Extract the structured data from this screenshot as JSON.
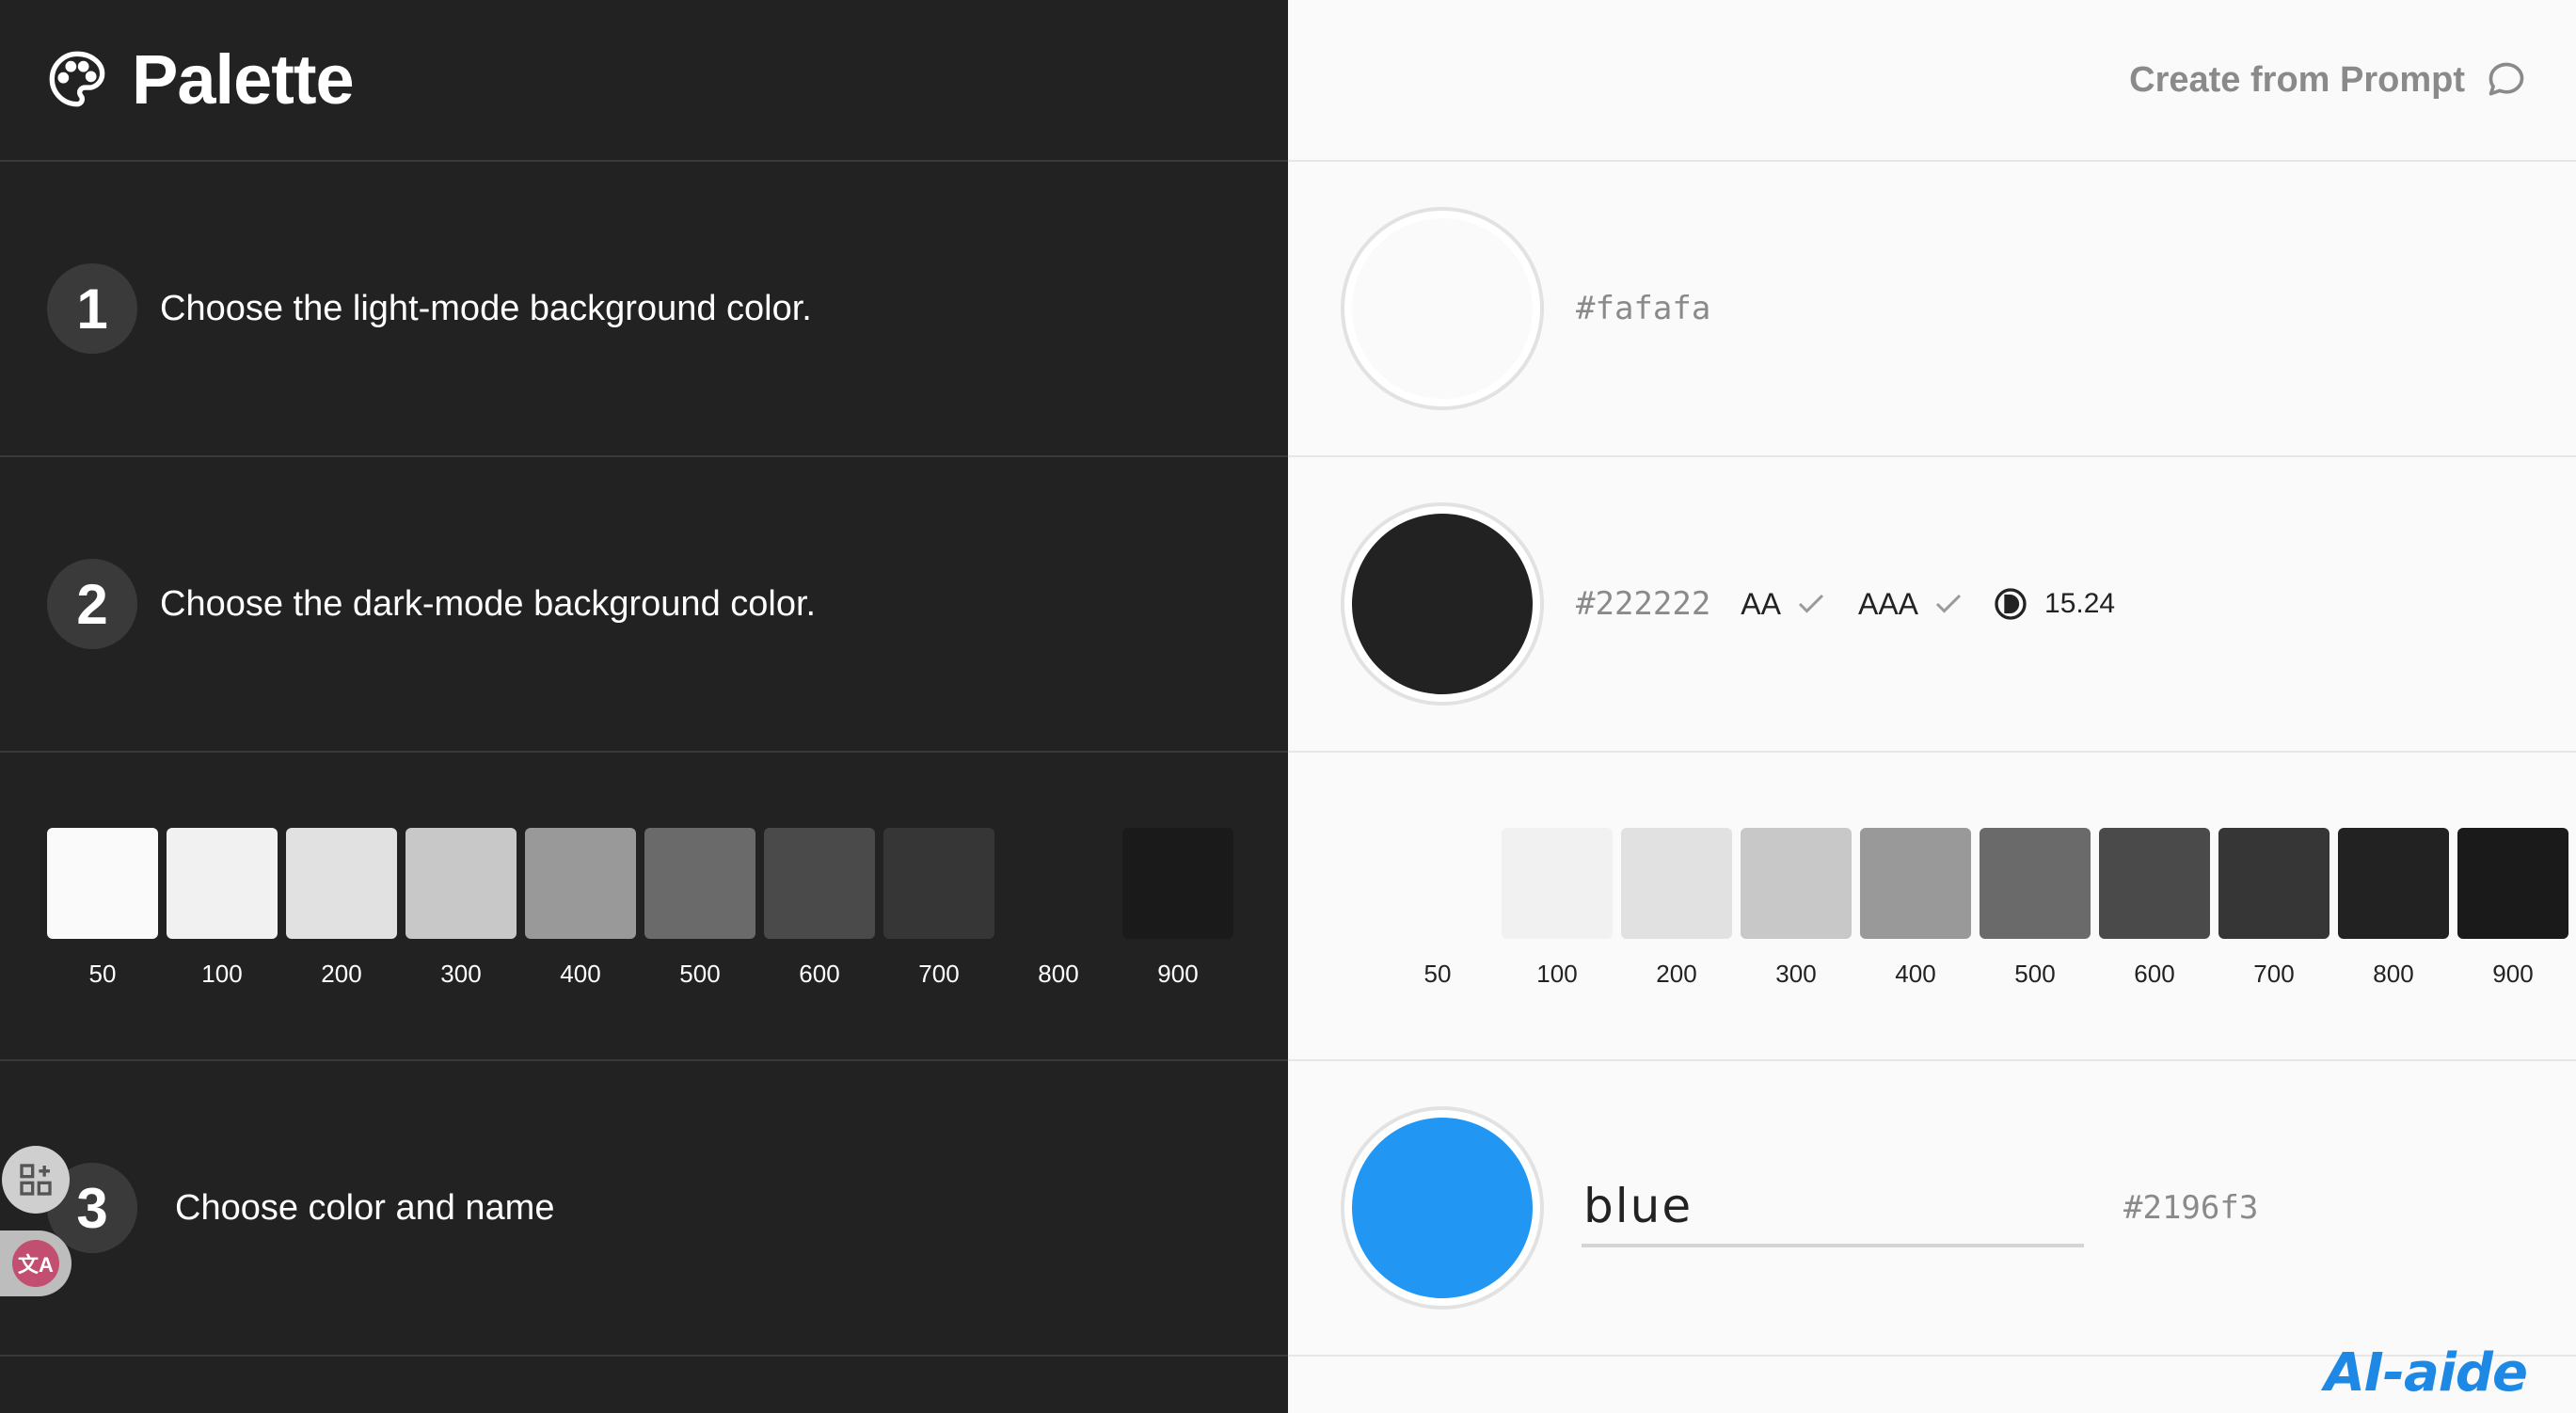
{
  "app": {
    "title": "Palette",
    "prompt_button": "Create from Prompt"
  },
  "steps": [
    {
      "number": "1",
      "label": "Choose the light-mode background color."
    },
    {
      "number": "2",
      "label": "Choose the dark-mode background color."
    },
    {
      "number": "3",
      "label": "Choose color and name"
    }
  ],
  "light_bg": {
    "hex": "#fafafa"
  },
  "dark_bg": {
    "hex": "#222222",
    "aa_label": "AA",
    "aaa_label": "AAA",
    "contrast_ratio": "15.24"
  },
  "scale": {
    "labels": [
      "50",
      "100",
      "200",
      "300",
      "400",
      "500",
      "600",
      "700",
      "800",
      "900"
    ],
    "left_colors": [
      "#fafafa",
      "#f1f1f1",
      "#e1e1e1",
      "#c8c8c8",
      "#999999",
      "#6a6a6a",
      "#4a4a4a",
      "#363636",
      "#222222",
      "#1a1a1a"
    ],
    "right_colors": [
      "#fafafa",
      "#f1f1f1",
      "#e1e1e1",
      "#c8c8c8",
      "#999999",
      "#6a6a6a",
      "#4a4a4a",
      "#363636",
      "#222222",
      "#1a1a1a"
    ]
  },
  "primary": {
    "name": "blue",
    "hex": "#2196f3"
  },
  "watermark": "AI-aide",
  "icons": {
    "brand": "palette-icon",
    "prompt": "chat-bubble-icon",
    "check": "check-icon",
    "contrast": "contrast-icon",
    "grid": "grid-add-icon",
    "translate": "translate-icon"
  }
}
